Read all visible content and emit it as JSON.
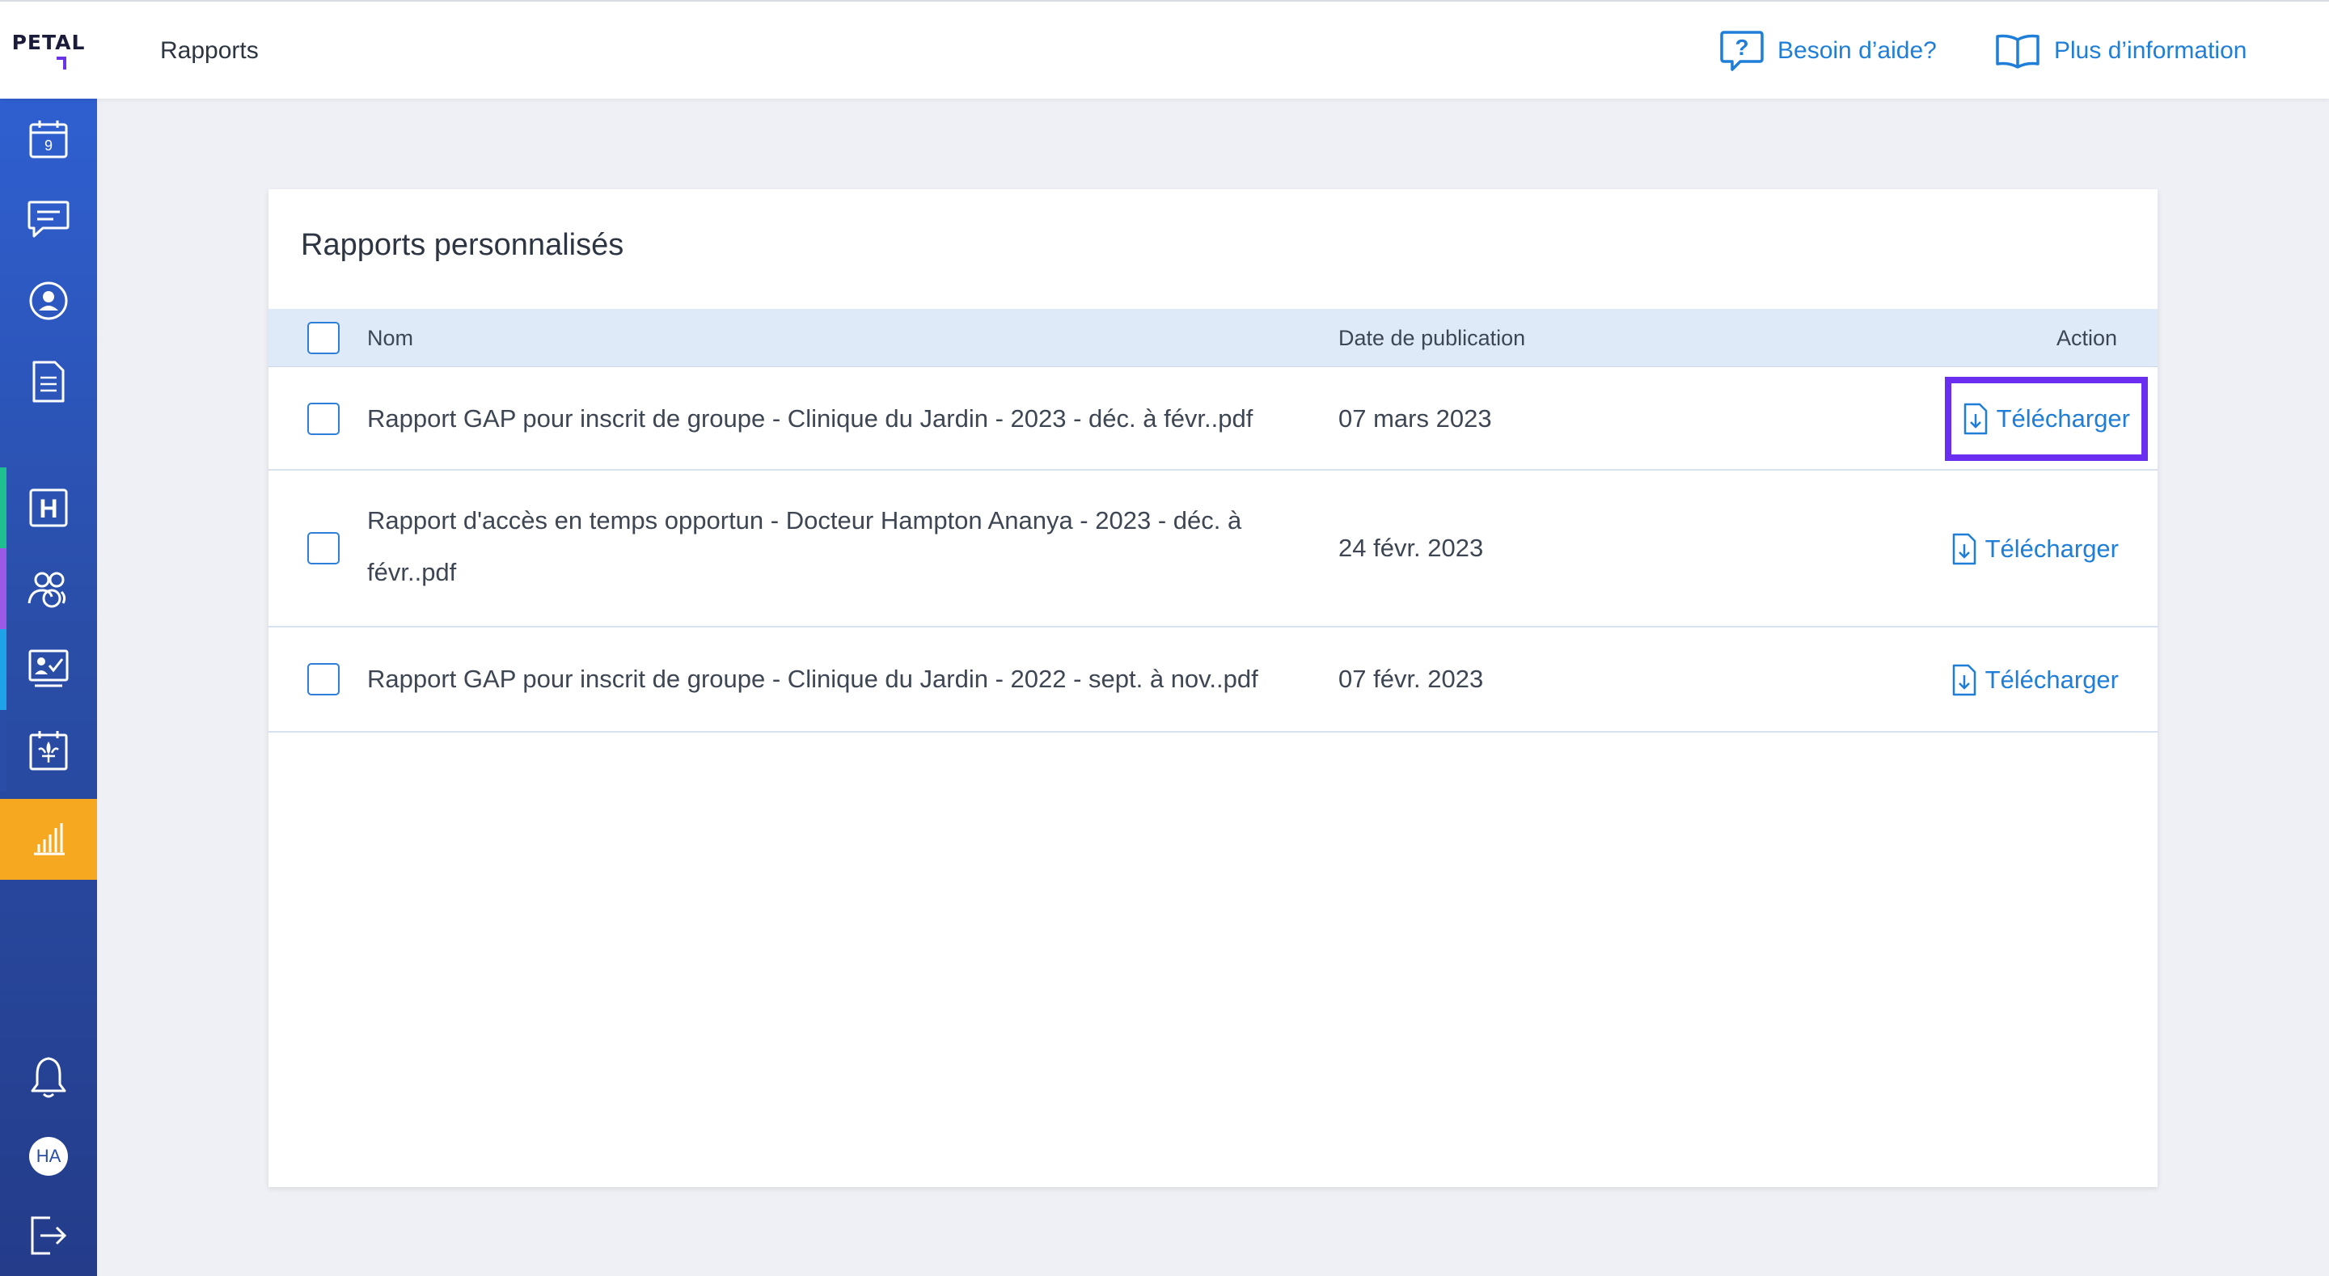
{
  "brand": {
    "logo_text": "PETAL"
  },
  "header": {
    "title": "Rapports",
    "help_label": "Besoin d’aide?",
    "info_label": "Plus d’information"
  },
  "sidebar": {
    "calendar_day": "9",
    "avatar_initials": "HA",
    "active_item": "reports",
    "stripe_colors": [
      "#1fbf8f",
      "#9b59e6",
      "#1fa3e8",
      "#2a4ea8"
    ],
    "active_color": "#f6a821"
  },
  "card": {
    "title": "Rapports personnalisés",
    "columns": {
      "name": "Nom",
      "date": "Date de publication",
      "action": "Action"
    },
    "rows": [
      {
        "name": "Rapport GAP pour inscrit de groupe - Clinique du Jardin - 2023 - déc. à févr..pdf",
        "date": "07 mars 2023",
        "action": "Télécharger"
      },
      {
        "name": "Rapport d'accès en temps opportun - Docteur Hampton Ananya - 2023 - déc. à févr..pdf",
        "date": "24 févr. 2023",
        "action": "Télécharger"
      },
      {
        "name": "Rapport GAP pour inscrit de groupe - Clinique du Jardin - 2022 - sept. à nov..pdf",
        "date": "07 févr. 2023",
        "action": "Télécharger"
      }
    ]
  },
  "colors": {
    "accent": "#1e7ed8",
    "focus_outline": "#6a2ef0",
    "table_header_bg": "#dfeaf8"
  }
}
